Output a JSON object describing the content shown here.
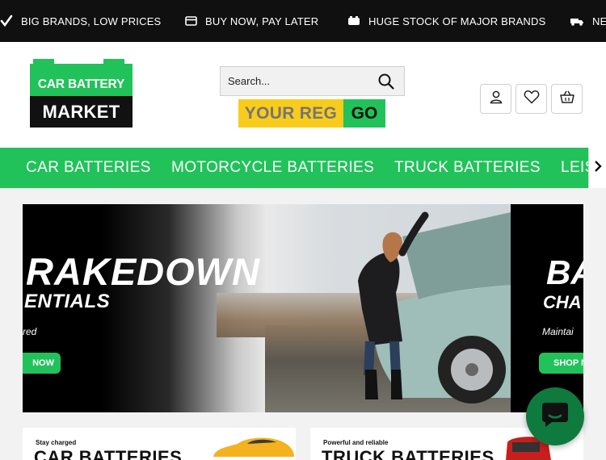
{
  "promo": {
    "items": [
      {
        "label": "BIG BRANDS, LOW PRICES",
        "icon": "check-icon"
      },
      {
        "label": "BUY NOW, PAY LATER",
        "icon": "card-icon"
      },
      {
        "label": "HUGE STOCK OF MAJOR BRANDS",
        "icon": "battery-icon"
      },
      {
        "label": "NE",
        "icon": "van-icon"
      }
    ]
  },
  "header": {
    "logo_top": "CAR BATTERY",
    "logo_bottom": "MARKET",
    "search_placeholder": "Search...",
    "reg_placeholder": "YOUR REG",
    "go_label": "GO"
  },
  "nav": {
    "items": [
      "CAR BATTERIES",
      "MOTORCYCLE BATTERIES",
      "TRUCK BATTERIES",
      "LEIS"
    ]
  },
  "banner": {
    "heading": "RAKEDOWN",
    "subheading": "ENTIALS",
    "tagline": "red",
    "cta": "NOW",
    "next_heading": "BA",
    "next_subheading": "CHA",
    "next_tagline": "Maintai",
    "next_cta": "SHOP N"
  },
  "cards": [
    {
      "kicker": "Stay charged",
      "title": "CAR BATTERIES"
    },
    {
      "kicker": "Powerful and reliable",
      "title": "TRUCK BATTERIES"
    }
  ],
  "colors": {
    "brand_green": "#21c25a",
    "reg_yellow": "#f8cc1b",
    "dark": "#101010"
  }
}
